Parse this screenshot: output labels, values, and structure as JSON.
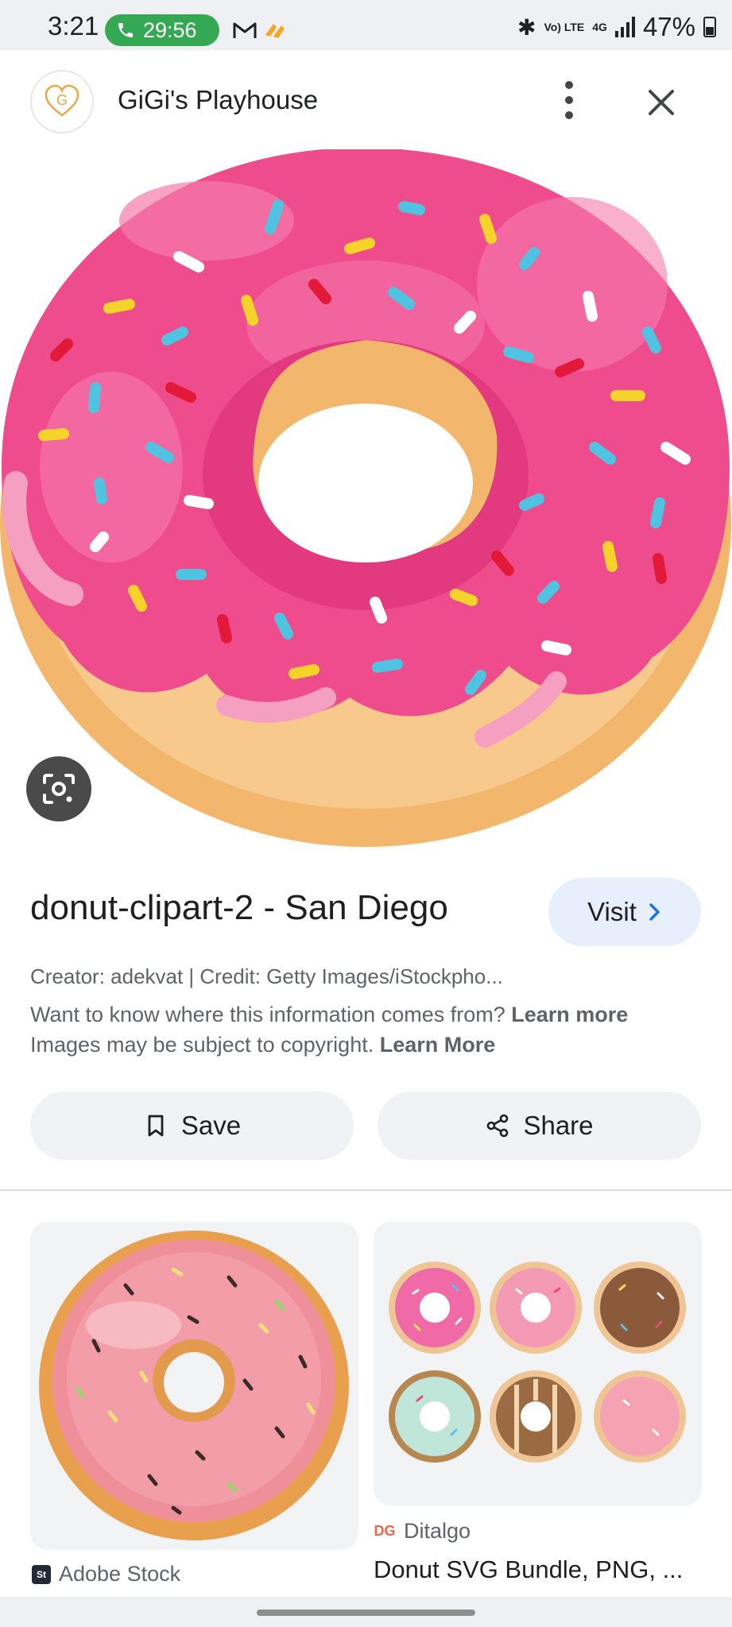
{
  "status_bar": {
    "time": "3:21",
    "call_timer": "29:56",
    "battery": "47%",
    "network_lte": "Vo) LTE",
    "network_4g": "4G"
  },
  "header": {
    "site_name": "GiGi's Playhouse",
    "logo_letter": "G"
  },
  "image": {
    "title": "donut-clipart-2 - San Diego",
    "visit_label": "Visit",
    "credit": "Creator: adekvat | Credit: Getty Images/iStockpho...",
    "info_text": "Want to know where this information comes from?",
    "info_link": "Learn more",
    "copyright_text": "Images may be subject to copyright.",
    "copyright_link": "Learn More"
  },
  "actions": {
    "save_label": "Save",
    "share_label": "Share"
  },
  "related": [
    {
      "source": "Adobe Stock",
      "source_icon": "St"
    },
    {
      "source": "Ditalgo",
      "source_icon": "DG",
      "title": "Donut SVG Bundle, PNG, ..."
    }
  ],
  "colors": {
    "icing": "#ef4c8e",
    "dough": "#f2b66c",
    "visit_bg": "#e8effc",
    "call_green": "#34a853"
  }
}
